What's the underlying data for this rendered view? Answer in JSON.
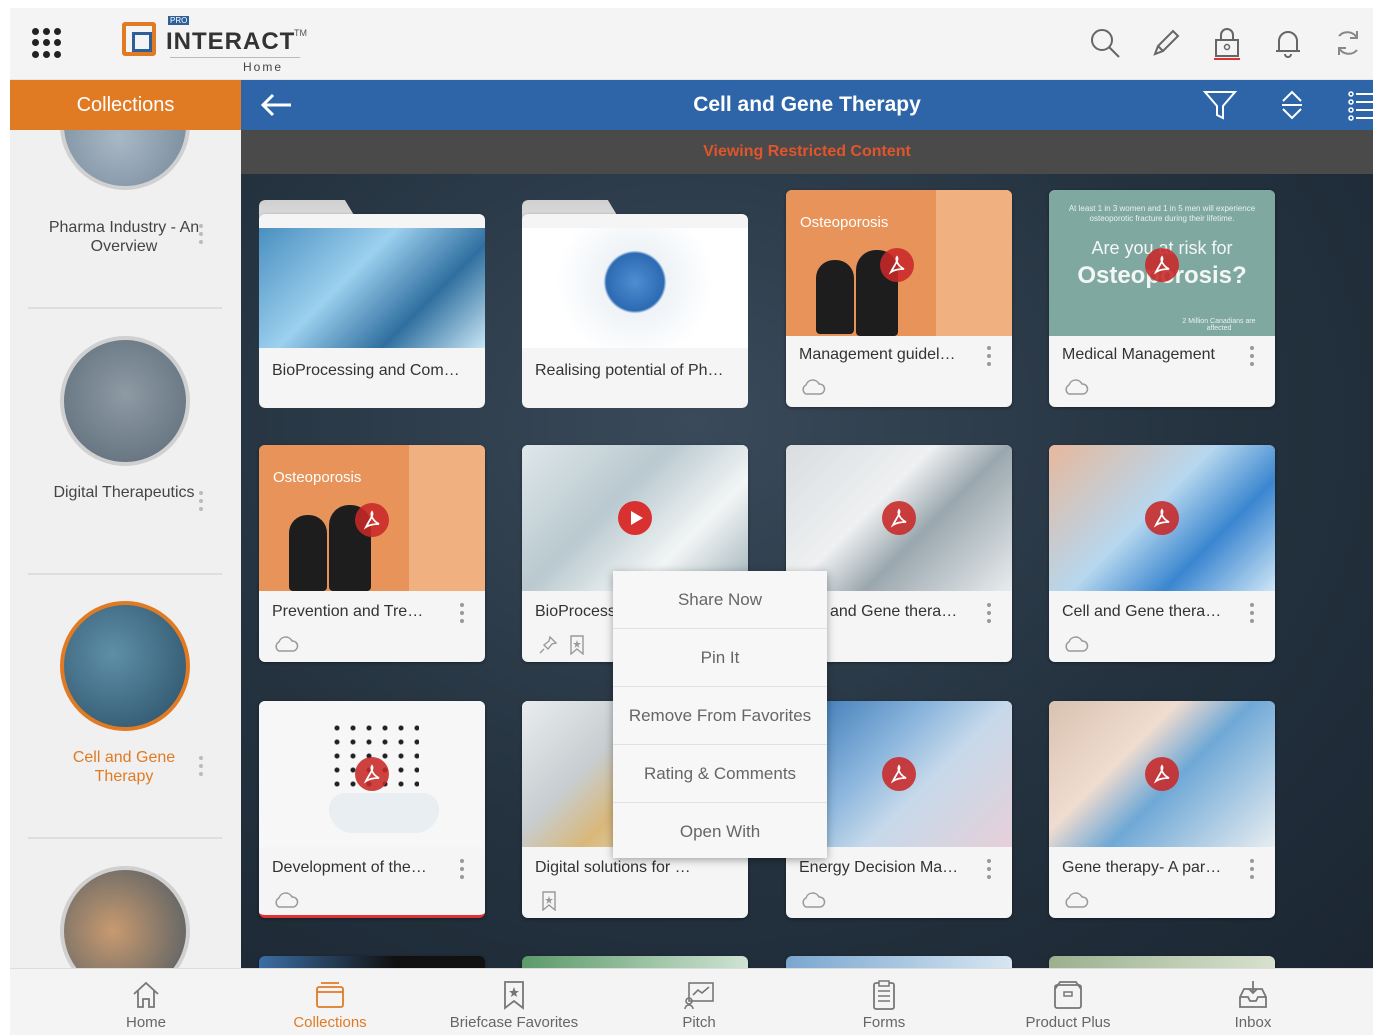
{
  "app": {
    "logo_pro": "PRO",
    "logo_name": "INTERACT",
    "logo_tm": "TM",
    "logo_sub": "Home"
  },
  "topbar_icons": [
    "search-icon",
    "pencil-icon",
    "lock-icon",
    "bell-icon",
    "sync-icon"
  ],
  "header": {
    "collections_label": "Collections",
    "title": "Cell and Gene Therapy",
    "restricted_banner": "Viewing Restricted Content"
  },
  "sidebar": {
    "items": [
      {
        "label": "Pharma Industry - An Overview"
      },
      {
        "label": "Digital Therapeutics"
      },
      {
        "label": "Cell and Gene Therapy"
      },
      {
        "label": ""
      }
    ]
  },
  "cards": [
    {
      "title": "BioProcessing and Com…",
      "type": "folder"
    },
    {
      "title": "Realising potential of Ph…",
      "type": "folder"
    },
    {
      "title": "Management guidel…",
      "type": "pdf",
      "thumb_title": "Osteoporosis"
    },
    {
      "title": "Medical Management",
      "type": "pdf",
      "thumb_title": "Are you at risk for",
      "thumb_title2": "Osteoporosis?",
      "thumb_top": "At least 1 in 3 women and 1 in 5 men will experience osteoporotic fracture during their lifetime.",
      "thumb_note": "2 Million Canadians are affected"
    },
    {
      "title": "Prevention and Tre…",
      "type": "pdf",
      "thumb_title": "Osteoporosis"
    },
    {
      "title": "BioProcess",
      "type": "video"
    },
    {
      "title": "and Gene thera…",
      "type": "pdf"
    },
    {
      "title": "Cell and Gene thera…",
      "type": "pdf"
    },
    {
      "title": "Development of the…",
      "type": "pdf"
    },
    {
      "title": "Digital solutions for …",
      "type": "pdf"
    },
    {
      "title": "Energy Decision Ma…",
      "type": "pdf"
    },
    {
      "title": "Gene therapy- A par…",
      "type": "pdf"
    }
  ],
  "context_menu": {
    "items": [
      "Share Now",
      "Pin It",
      "Remove From Favorites",
      "Rating & Comments",
      "Open With"
    ]
  },
  "bottom_nav": {
    "items": [
      {
        "label": "Home",
        "icon": "home-icon"
      },
      {
        "label": "Collections",
        "icon": "collections-icon",
        "active": true
      },
      {
        "label": "Briefcase Favorites",
        "icon": "briefcase-favorites-icon"
      },
      {
        "label": "Pitch",
        "icon": "pitch-icon"
      },
      {
        "label": "Forms",
        "icon": "forms-icon"
      },
      {
        "label": "Product Plus",
        "icon": "product-plus-icon"
      },
      {
        "label": "Inbox",
        "icon": "inbox-icon"
      }
    ]
  },
  "colors": {
    "accent": "#e07b24",
    "header_blue": "#2e65a8",
    "restricted_red": "#e0552b"
  }
}
